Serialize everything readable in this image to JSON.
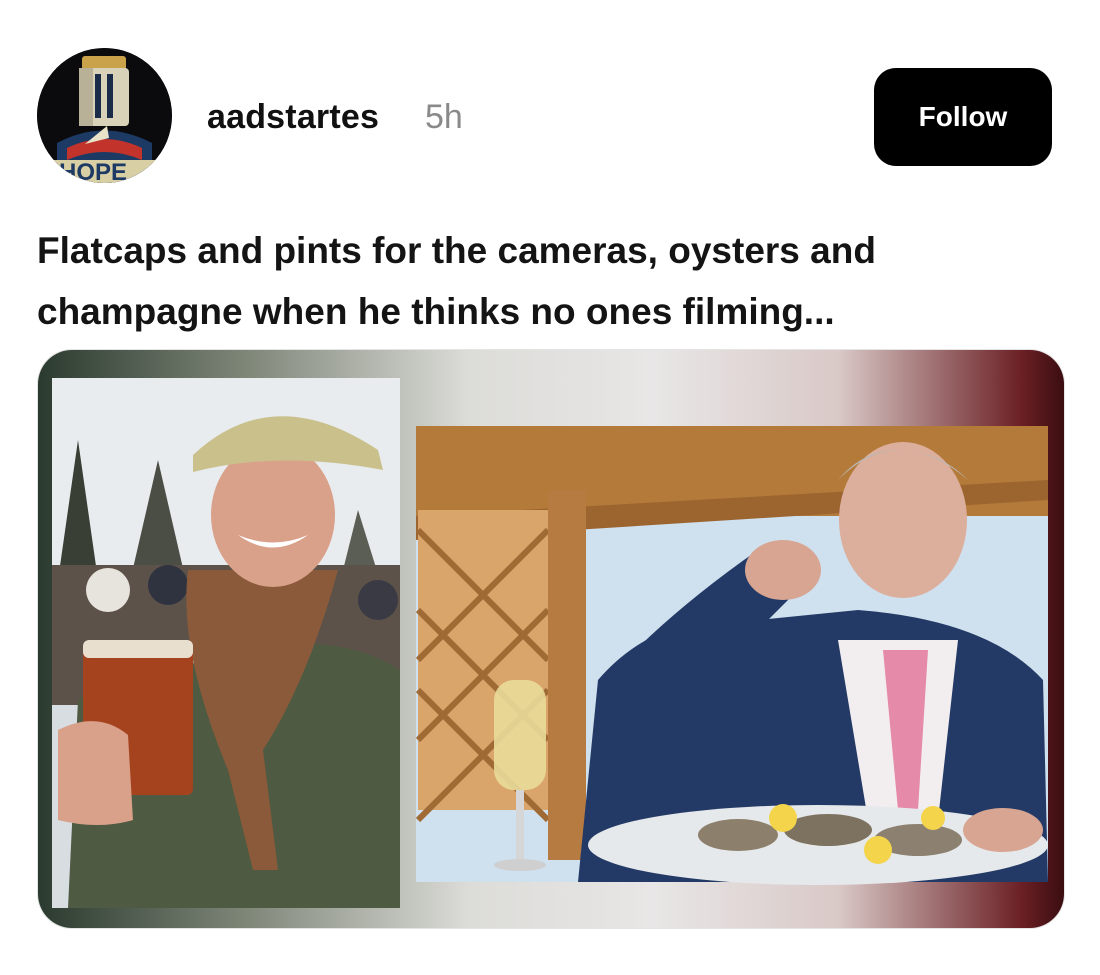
{
  "post": {
    "avatar": {
      "icon": "knight-helmet-hope-poster",
      "label": "HOPE"
    },
    "username": "aadstartes",
    "timestamp": "5h",
    "follow_label": "Follow",
    "caption": "Flatcaps and pints for the cameras, oysters and champagne when he thinks no ones filming...",
    "media": {
      "left_photo": "man-in-flat-cap-holding-pint",
      "right_photo": "man-in-suit-eating-oysters-with-champagne"
    }
  },
  "colors": {
    "follow_button_bg": "#000000",
    "follow_button_text": "#ffffff",
    "timestamp": "#8a8a8a",
    "text": "#111111"
  }
}
